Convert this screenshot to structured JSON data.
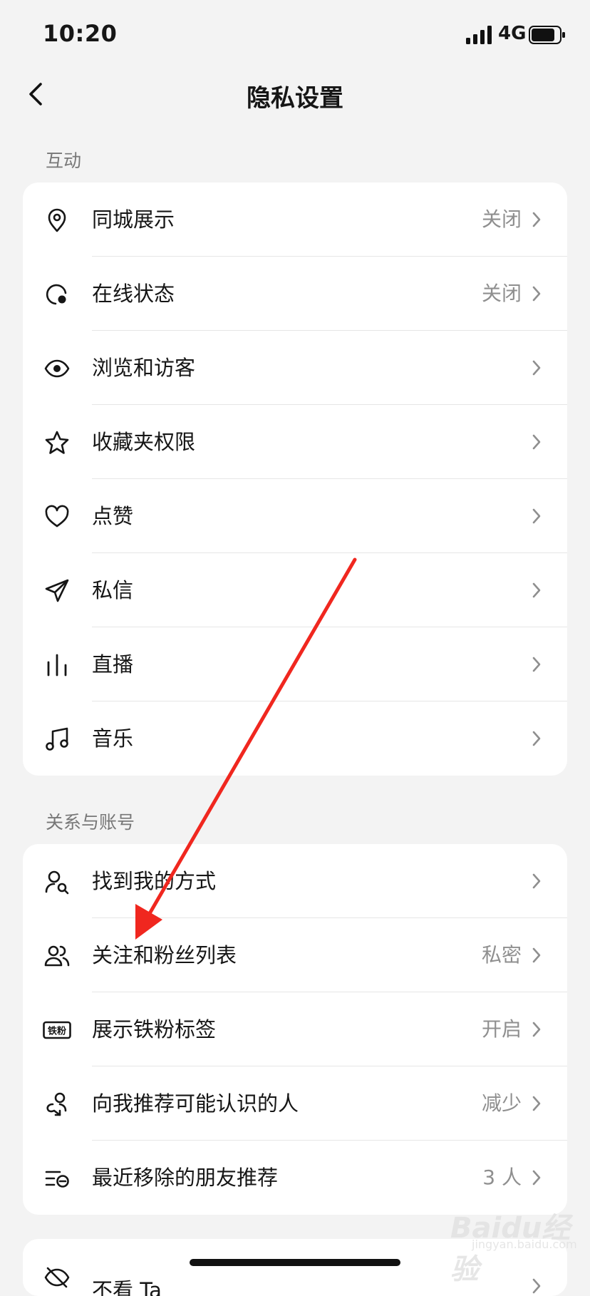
{
  "status_bar": {
    "time": "10:20",
    "network": "4G"
  },
  "nav": {
    "title": "隐私设置"
  },
  "sections": [
    {
      "label": "互动",
      "rows": [
        {
          "icon": "location-pin-icon",
          "label": "同城展示",
          "value": "关闭"
        },
        {
          "icon": "online-status-icon",
          "label": "在线状态",
          "value": "关闭"
        },
        {
          "icon": "eye-icon",
          "label": "浏览和访客",
          "value": ""
        },
        {
          "icon": "star-icon",
          "label": "收藏夹权限",
          "value": ""
        },
        {
          "icon": "heart-icon",
          "label": "点赞",
          "value": ""
        },
        {
          "icon": "paper-plane-icon",
          "label": "私信",
          "value": ""
        },
        {
          "icon": "live-bars-icon",
          "label": "直播",
          "value": ""
        },
        {
          "icon": "music-note-icon",
          "label": "音乐",
          "value": ""
        }
      ]
    },
    {
      "label": "关系与账号",
      "rows": [
        {
          "icon": "user-search-icon",
          "label": "找到我的方式",
          "value": ""
        },
        {
          "icon": "users-icon",
          "label": "关注和粉丝列表",
          "value": "私密"
        },
        {
          "icon": "iron-fan-badge-icon",
          "label": "展示铁粉标签",
          "value": "开启",
          "badge_text": "铁粉"
        },
        {
          "icon": "recommend-people-icon",
          "label": "向我推荐可能认识的人",
          "value": "减少"
        },
        {
          "icon": "removed-list-icon",
          "label": "最近移除的朋友推荐",
          "value": "3 人"
        }
      ]
    },
    {
      "label": "",
      "rows": [
        {
          "icon": "eye-off-icon",
          "label": "不看 Ta",
          "value": ""
        }
      ]
    }
  ],
  "annotation": {
    "color": "#f0271f"
  },
  "watermark": {
    "text": "Baidu经验",
    "sub": "jingyan.baidu.com"
  }
}
